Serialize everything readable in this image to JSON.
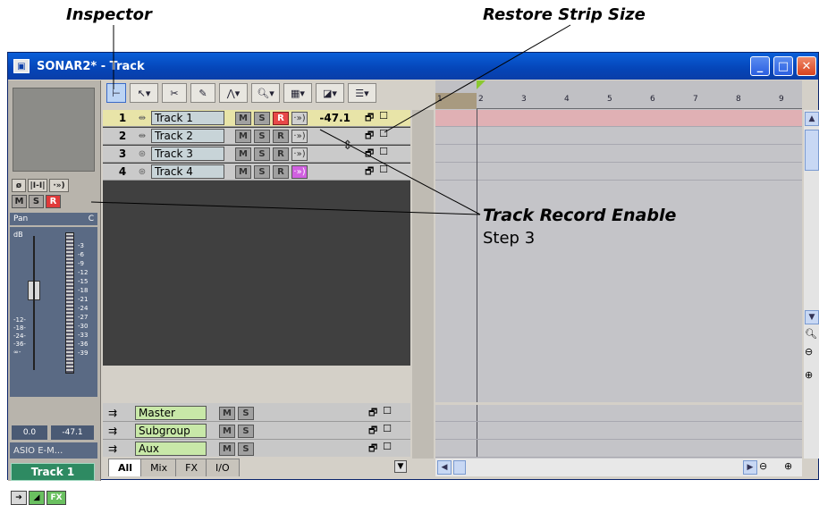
{
  "annotations": {
    "inspector": "Inspector",
    "restore_strip_size": "Restore Strip Size",
    "track_record_enable": "Track Record Enable",
    "step": "Step 3"
  },
  "window": {
    "app_name": "SONAR2*",
    "separator": " - ",
    "view_name": "Track",
    "title_color": "#0545b8"
  },
  "inspector": {
    "phase_label": "ø",
    "io_label": "|I-I|",
    "mon_label": "·»)",
    "mute": "M",
    "solo": "S",
    "rec": "R",
    "pan_label": "Pan",
    "pan_value": "C",
    "db_label": "dB",
    "scale_left": [
      "-12-",
      "-18-",
      "-24-",
      "-36-",
      "∞-"
    ],
    "scale_right": [
      "-3",
      "-6",
      "-9",
      "-12",
      "-15",
      "-18",
      "-21",
      "-24",
      "-27",
      "-30",
      "-33",
      "-36",
      "-39"
    ],
    "vol_value": "0.0",
    "peak_value": "-47.1",
    "output": "ASIO E-M...",
    "track_name": "Track 1",
    "fx_label": "FX"
  },
  "tracks": [
    {
      "num": "1",
      "name": "Track 1",
      "mute": "M",
      "solo": "S",
      "rec": "R",
      "mon": "·»)",
      "vol": "-47.1",
      "selected": true,
      "rec_on": true,
      "mon_on": false
    },
    {
      "num": "2",
      "name": "Track 2",
      "mute": "M",
      "solo": "S",
      "rec": "R",
      "mon": "·»)",
      "vol": "",
      "selected": false,
      "rec_on": false,
      "mon_on": false
    },
    {
      "num": "3",
      "name": "Track 3",
      "mute": "M",
      "solo": "S",
      "rec": "R",
      "mon": "·»)",
      "vol": "",
      "selected": false,
      "rec_on": false,
      "mon_on": false
    },
    {
      "num": "4",
      "name": "Track 4",
      "mute": "M",
      "solo": "S",
      "rec": "R",
      "mon": "·»)",
      "vol": "",
      "selected": false,
      "rec_on": false,
      "mon_on": true
    }
  ],
  "buses": [
    {
      "name": "Master",
      "mute": "M",
      "solo": "S"
    },
    {
      "name": "Subgroup",
      "mute": "M",
      "solo": "S"
    },
    {
      "name": "Aux",
      "mute": "M",
      "solo": "S"
    }
  ],
  "tabs": [
    "All",
    "Mix",
    "FX",
    "I/O"
  ],
  "ruler": [
    "1",
    "2",
    "3",
    "4",
    "5",
    "6",
    "7",
    "8",
    "9"
  ],
  "colors": {
    "record": "#e84848",
    "selected_track": "#e8e4a8",
    "selected_lane": "#e0b0b4",
    "inspector_track": "#2e8a62"
  }
}
